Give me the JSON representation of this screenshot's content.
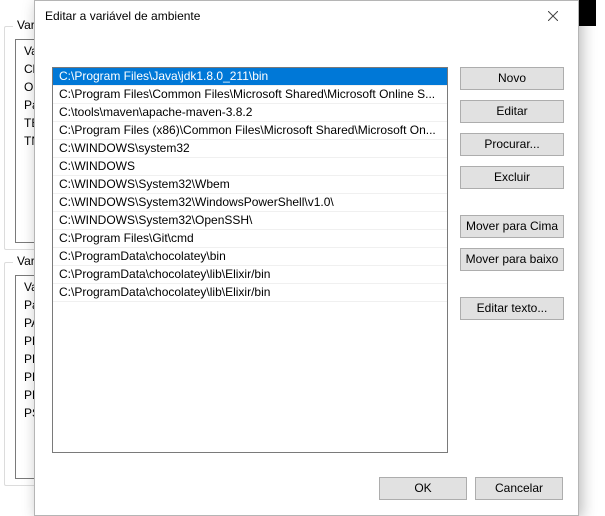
{
  "background": {
    "group_top_title": "Variáveis",
    "group_bottom_title": "Variáveis",
    "top_items": [
      "Va",
      "Cl",
      "Or",
      "Pa",
      "TE",
      "TN"
    ],
    "bottom_items": [
      "Va",
      "Pa",
      "PA",
      "PF",
      "PF",
      "PF",
      "PF",
      "PS"
    ]
  },
  "dialog": {
    "title": "Editar a variável de ambiente",
    "entries": [
      "C:\\Program Files\\Java\\jdk1.8.0_211\\bin",
      "C:\\Program Files\\Common Files\\Microsoft Shared\\Microsoft Online S...",
      "C:\\tools\\maven\\apache-maven-3.8.2",
      "C:\\Program Files (x86)\\Common Files\\Microsoft Shared\\Microsoft On...",
      "C:\\WINDOWS\\system32",
      "C:\\WINDOWS",
      "C:\\WINDOWS\\System32\\Wbem",
      "C:\\WINDOWS\\System32\\WindowsPowerShell\\v1.0\\",
      "C:\\WINDOWS\\System32\\OpenSSH\\",
      "C:\\Program Files\\Git\\cmd",
      "C:\\ProgramData\\chocolatey\\bin",
      "C:\\ProgramData\\chocolatey\\lib\\Elixir/bin",
      "C:\\ProgramData\\chocolatey\\lib\\Elixir/bin"
    ],
    "selected_index": 0,
    "buttons": {
      "new": "Novo",
      "edit": "Editar",
      "browse": "Procurar...",
      "delete": "Excluir",
      "move_up": "Mover para Cima",
      "move_down": "Mover para baixo",
      "edit_text": "Editar texto...",
      "ok": "OK",
      "cancel": "Cancelar"
    }
  }
}
